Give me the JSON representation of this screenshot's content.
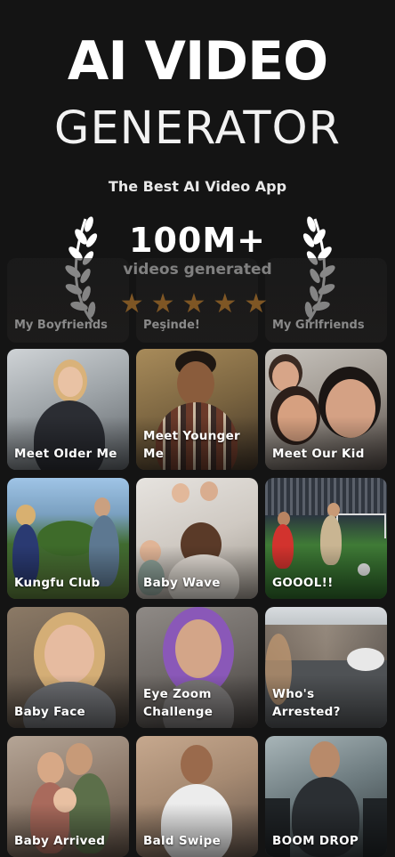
{
  "header": {
    "title_line1": "AI VIDEO",
    "title_line2": "GENERATOR",
    "subtitle": "The Best AI Video App",
    "count": "100M+",
    "count_label": "videos generated",
    "stars": "★★★★★",
    "rating": 5
  },
  "previous_row": [
    {
      "label": "My Boyfriends"
    },
    {
      "label": "Peşinde!"
    },
    {
      "label": "My Girlfriends"
    }
  ],
  "tiles": [
    {
      "label": "Meet Older Me"
    },
    {
      "label": "Meet Younger Me"
    },
    {
      "label": "Meet Our Kid"
    },
    {
      "label": "Kungfu Club"
    },
    {
      "label": "Baby Wave"
    },
    {
      "label": "GOOOL!!"
    },
    {
      "label": "Baby Face"
    },
    {
      "label": "Eye Zoom Challenge"
    },
    {
      "label": "Who's Arrested?"
    },
    {
      "label": "Baby Arrived"
    },
    {
      "label": "Bald Swipe"
    },
    {
      "label": "BOOM DROP"
    }
  ],
  "colors": {
    "background": "#141414",
    "star": "#f5a037",
    "text": "#ffffff"
  },
  "icons": {
    "laurel_left": "laurel-left-icon",
    "laurel_right": "laurel-right-icon"
  }
}
